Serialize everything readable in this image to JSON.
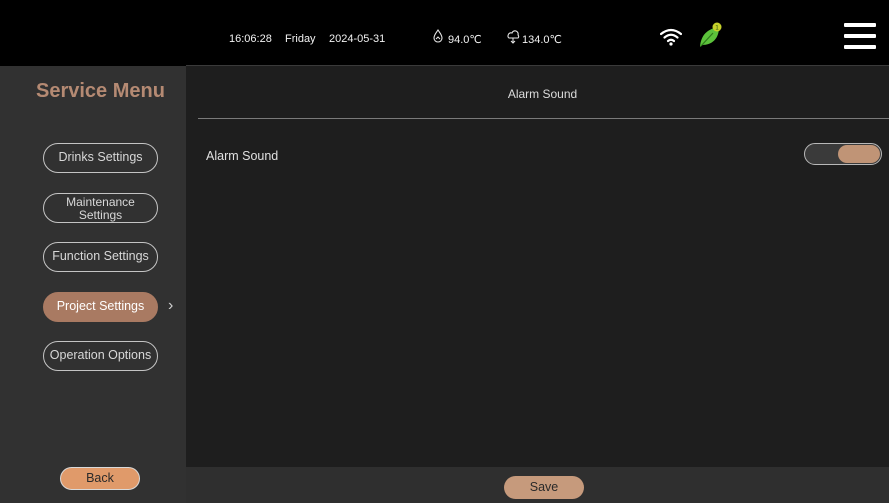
{
  "status": {
    "time": "16:06:28",
    "day": "Friday",
    "date": "2024-05-31",
    "temp1": "94.0℃",
    "temp2": "134.0℃",
    "icons": [
      "temperature-drop-icon",
      "steam-icon",
      "wifi-icon",
      "leaf-icon",
      "hamburger-menu-icon"
    ]
  },
  "sidebar": {
    "title": "Service Menu",
    "items": [
      {
        "label": "Drinks Settings",
        "active": false
      },
      {
        "label": "Maintenance Settings",
        "active": false
      },
      {
        "label": "Function Settings",
        "active": false
      },
      {
        "label": "Project Settings",
        "active": true
      },
      {
        "label": "Operation Options",
        "active": false
      }
    ],
    "back_label": "Back"
  },
  "main": {
    "header": "Alarm Sound",
    "rows": [
      {
        "label": "Alarm Sound",
        "enabled": true
      }
    ]
  },
  "footer": {
    "save_label": "Save"
  },
  "colors": {
    "accent": "#b58a73",
    "active_pill": "#a97a62",
    "back_button": "#e09a6a",
    "save_button": "#c69a7c",
    "leaf": "#5cc23b"
  }
}
